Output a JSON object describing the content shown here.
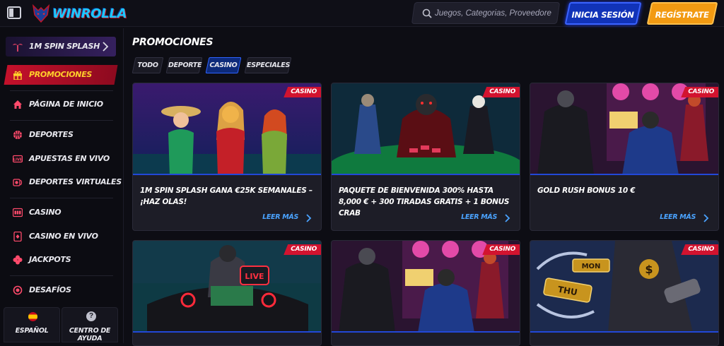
{
  "header": {
    "brand": "WinRolla",
    "search": {
      "placeholder": "Juegos, Categorias, Proveedores",
      "value": ""
    },
    "login_label": "INICIA SESIÓN",
    "register_label": "REGÍSTRATE"
  },
  "sidebar": {
    "items": [
      {
        "label": "1M SPIN SPLASH",
        "icon": "palm-tree-icon"
      },
      {
        "label": "PROMOCIONES",
        "icon": "gift-icon",
        "active": true
      },
      {
        "label": "PÁGINA DE INICIO",
        "icon": "home-icon"
      },
      {
        "label": "DEPORTES",
        "icon": "basketball-icon"
      },
      {
        "label": "APUESTAS EN VIVO",
        "icon": "live-icon"
      },
      {
        "label": "DEPORTES VIRTUALES",
        "icon": "virtual-sports-icon"
      },
      {
        "label": "CASINO",
        "icon": "slot-machine-icon"
      },
      {
        "label": "CASINO EN VIVO",
        "icon": "live-casino-icon"
      },
      {
        "label": "JACKPOTS",
        "icon": "clover-icon"
      },
      {
        "label": "DESAFÍOS",
        "icon": "challenge-icon"
      }
    ],
    "language_label": "ESPAÑOL",
    "help_label": "CENTRO DE AYUDA"
  },
  "main": {
    "title": "PROMOCIONES",
    "filters": [
      {
        "label": "TODO",
        "active": false
      },
      {
        "label": "DEPORTE",
        "active": false
      },
      {
        "label": "CASINO",
        "active": true
      },
      {
        "label": "ESPECIALES",
        "active": false
      }
    ],
    "cards": [
      {
        "badge": "CASINO",
        "title": "1M SPIN SPLASH GANA €25K SEMANALES – ¡HAZ OLAS!",
        "link": "LEER MÁS"
      },
      {
        "badge": "CASINO",
        "title": "PAQUETE DE BIENVENIDA 300% HASTA 8,000 € + 300 TIRADAS GRATIS + 1 BONUS CRAB",
        "link": "LEER MÁS"
      },
      {
        "badge": "CASINO",
        "title": "GOLD RUSH BONUS 10 €",
        "link": "LEER MÁS"
      },
      {
        "badge": "CASINO",
        "image_text": "LIVE",
        "title": "",
        "link": ""
      },
      {
        "badge": "CASINO",
        "title": "",
        "link": ""
      },
      {
        "badge": "CASINO",
        "image_text": [
          "MON",
          "THU"
        ],
        "title": "",
        "link": ""
      }
    ]
  },
  "colors": {
    "accent_blue": "#2248d8",
    "accent_red": "#d2132f",
    "accent_orange": "#f29a12",
    "link_blue": "#4aa3ff",
    "active_yellow": "#ffd02b"
  }
}
